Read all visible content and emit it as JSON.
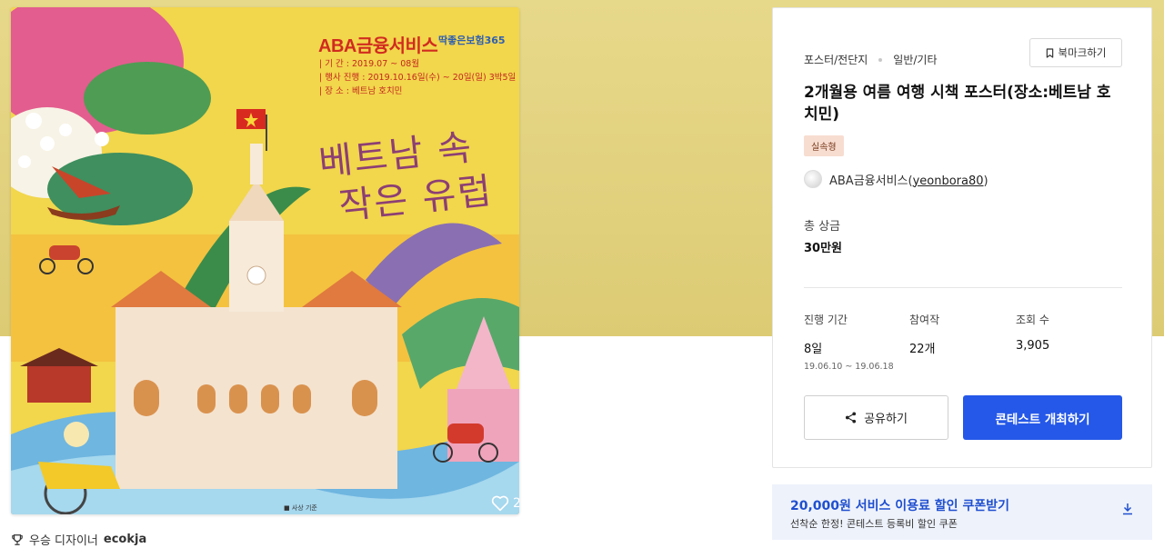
{
  "poster": {
    "brand": "ABA금융서비스",
    "brand2": "딱좋은보험365",
    "info": [
      "| 기 간 : 2019.07 ~ 08월",
      "| 행사 진행 : 2019.10.16일(수) ~ 20일(일) 3박5일",
      "| 장 소 : 베트남 호치민"
    ],
    "title_line1": "베트남 속",
    "title_line2": "작은 유럽",
    "note": "■ 사상 기준",
    "likes": "2"
  },
  "winner": {
    "label": "우승 디자이너",
    "name": "ecokja"
  },
  "card": {
    "category": "포스터/전단지",
    "subcategory": "일반/기타",
    "bookmark_label": "북마크하기",
    "title": "2개월용 여름 여행 시책 포스터(장소:베트남 호치민)",
    "badge": "실속형",
    "host_name": "ABA금융서비스",
    "host_id": "yeonbora80",
    "prize_label": "총 상금",
    "prize_value": "30만원",
    "stats": {
      "period_label": "진행 기간",
      "period_value": "8일",
      "period_range": "19.06.10 ~ 19.06.18",
      "entries_label": "참여작",
      "entries_value": "22개",
      "views_label": "조회 수",
      "views_value": "3,905"
    },
    "share_label": "공유하기",
    "host_button_label": "콘테스트 개최하기"
  },
  "coupon": {
    "title": "20,000원 서비스 이용료 할인 쿠폰받기",
    "subtitle": "선착순 한정! 콘테스트 등록비 할인 쿠폰"
  },
  "colors": {
    "accent": "#2558e8",
    "coupon_text": "#1f4fcf",
    "badge_bg": "#f7ddd0",
    "hero_bg": "#e1d07c"
  }
}
